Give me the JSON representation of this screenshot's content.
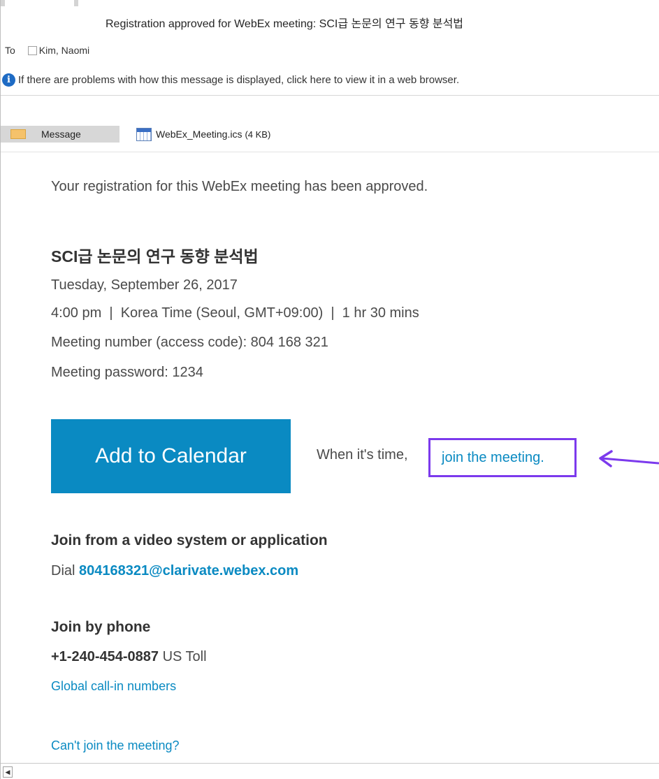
{
  "email": {
    "subject": "Registration approved for WebEx meeting: SCI급 논문의 연구 동향 분석법",
    "to_label": "To",
    "recipient": "Kim, Naomi",
    "info_bar": "If there are problems with how this message is displayed, click here to view it in a web browser."
  },
  "attachments_bar": {
    "message_tab": "Message",
    "attachment_name": "WebEx_Meeting.ics",
    "attachment_size": "(4 KB)"
  },
  "body": {
    "intro": "Your registration for this WebEx meeting has been approved.",
    "meeting_title": "SCI급 논문의 연구 동향 분석법",
    "date": "Tuesday, September 26, 2017",
    "time_line": "4:00 pm  |  Korea Time (Seoul, GMT+09:00)  |  1 hr 30 mins",
    "meeting_number": "Meeting number (access code): 804 168 321",
    "meeting_password": "Meeting password: 1234",
    "add_to_calendar": "Add to Calendar",
    "when_text": "When it's time,",
    "join_link": "join the meeting.",
    "video_heading": "Join from a video system or application",
    "dial_label": "Dial",
    "dial_address": "804168321@clarivate.webex.com",
    "phone_heading": "Join by phone",
    "phone_number": "+1-240-454-0887",
    "phone_type": "US Toll",
    "global_numbers": "Global call-in numbers",
    "cant_join": "Can't join the meeting?"
  },
  "colors": {
    "accent": "#0a8ac2",
    "annotation": "#7c3aed"
  }
}
